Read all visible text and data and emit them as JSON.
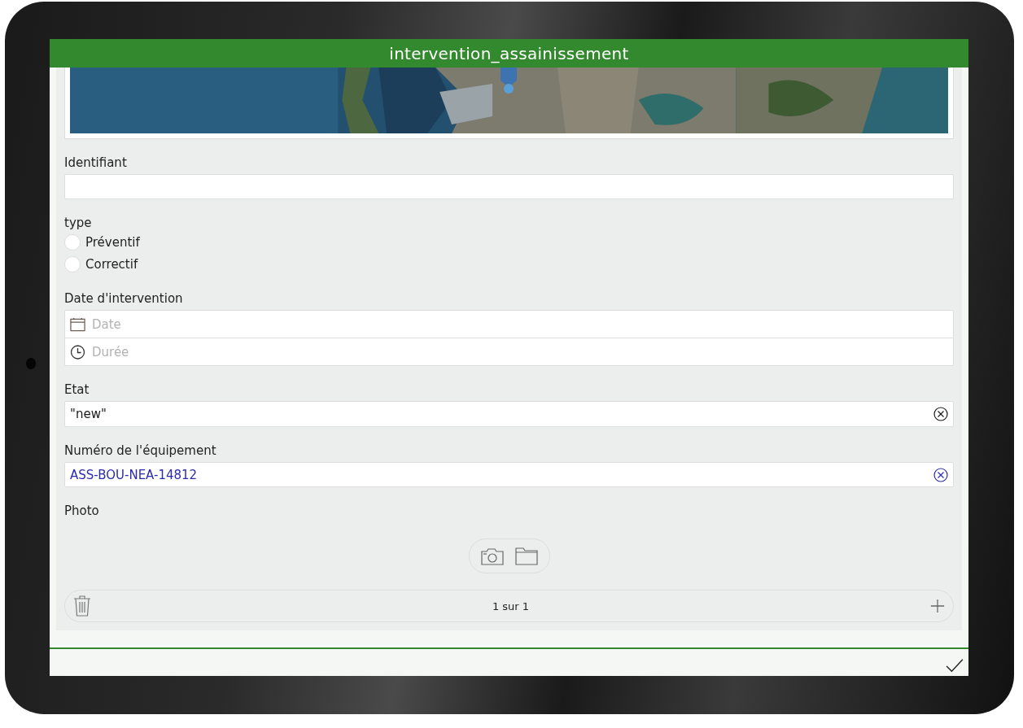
{
  "app_bar": {
    "title": "intervention_assainissement"
  },
  "fields": [
    {
      "kind": "text",
      "label": "Identifiant",
      "clearable": false
    },
    {
      "kind": "radio",
      "label": "type",
      "options": [
        {
          "label": "Préventif",
          "selected": false
        },
        {
          "label": "Correctif",
          "selected": false
        }
      ]
    },
    {
      "kind": "datetime",
      "label": "Date d'intervention",
      "date_placeholder": "Date",
      "time_placeholder": "Durée"
    },
    {
      "kind": "text",
      "label": "Etat",
      "value": "\"new\"",
      "color": "#1a1a1a",
      "clearable": true
    },
    {
      "kind": "text",
      "label": "Numéro de l'équipement",
      "value": "ASS-BOU-NEA-14812",
      "color": "#2b2bb0",
      "clearable": true
    },
    {
      "label": "Photo",
      "pager": "1 sur 1"
    }
  ]
}
